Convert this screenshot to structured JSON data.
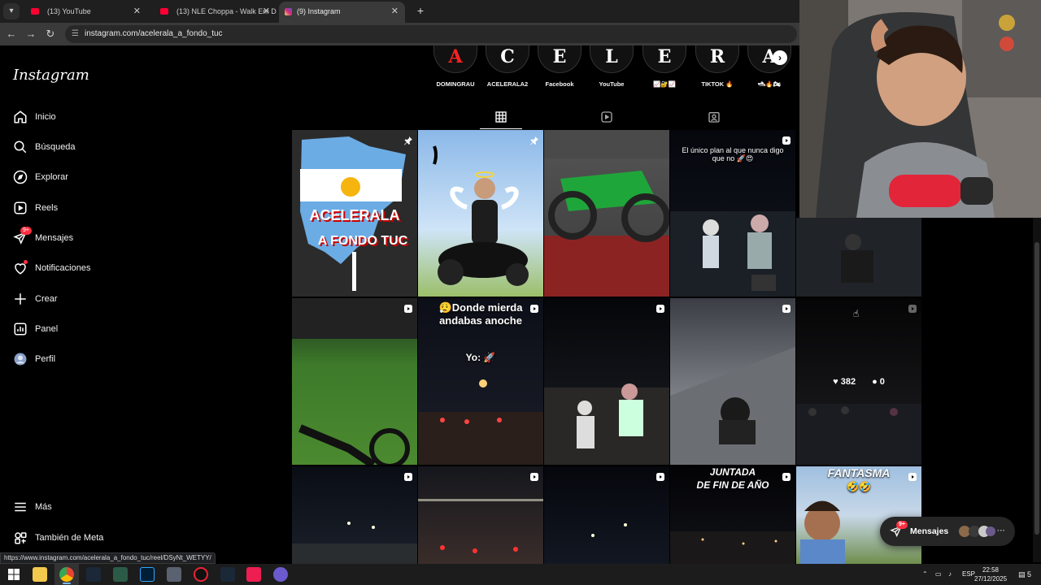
{
  "browser": {
    "tabs": [
      {
        "title": "(13) YouTube",
        "favicon_color": "#ff0033"
      },
      {
        "title": "(13) NLE Choppa - Walk Em Do",
        "favicon_color": "#ff0033"
      },
      {
        "title": "(9) Instagram",
        "favicon_color": "#e1306c"
      }
    ],
    "new_tab": "+",
    "url": "instagram.com/acelerala_a_fondo_tuc",
    "status_url": "https://www.instagram.com/acelerala_a_fondo_tuc/reel/DSyNt_WETYY/"
  },
  "sidebar": {
    "logo": "Instagram",
    "items": [
      {
        "label": "Inicio",
        "icon": "home-icon"
      },
      {
        "label": "Búsqueda",
        "icon": "search-icon"
      },
      {
        "label": "Explorar",
        "icon": "compass-icon"
      },
      {
        "label": "Reels",
        "icon": "reels-icon"
      },
      {
        "label": "Mensajes",
        "icon": "messenger-icon",
        "badge": "9+"
      },
      {
        "label": "Notificaciones",
        "icon": "heart-icon"
      },
      {
        "label": "Crear",
        "icon": "plus-icon"
      },
      {
        "label": "Panel",
        "icon": "dashboard-icon"
      },
      {
        "label": "Perfil",
        "icon": "avatar-icon"
      }
    ],
    "bottom": [
      {
        "label": "Más",
        "icon": "menu-icon"
      },
      {
        "label": "También de Meta",
        "icon": "meta-apps-icon"
      }
    ]
  },
  "highlights": [
    {
      "label": "DOMINGRAU",
      "glyph": "A",
      "glyph_color": "#ff2222"
    },
    {
      "label": "ACELERALA2",
      "glyph": "C",
      "glyph_color": "#ffffff"
    },
    {
      "label": "Facebook",
      "glyph": "E",
      "glyph_color": "#ffffff"
    },
    {
      "label": "YouTube",
      "glyph": "L",
      "glyph_color": "#ffffff"
    },
    {
      "label": "📈🔐📈",
      "glyph": "E",
      "glyph_color": "#ffffff"
    },
    {
      "label": "TIKTOK 🔥",
      "glyph": "R",
      "glyph_color": "#ffffff"
    },
    {
      "label": "🛥🔥🏍",
      "glyph": "A",
      "glyph_color": "#ffffff"
    }
  ],
  "profile_tabs": [
    "grid-icon",
    "reels-tab-icon",
    "tagged-icon"
  ],
  "posts": {
    "p1": {
      "title_line1": "ACELERALA",
      "title_line2": "A FONDO TUC"
    },
    "p4": {
      "caption": "El único plan al que nunca digo que no 🚀😍"
    },
    "p7": {
      "caption_line1": "😮‍💨Donde mierda",
      "caption_line2": "andabas anoche",
      "caption_line3": "Yo: 🚀"
    },
    "p10": {
      "likes": "382",
      "comments": "0"
    },
    "p14": {
      "caption_line1": "JUNTADA",
      "caption_line2": "DE FIN DE AÑO"
    },
    "p15": {
      "caption_line1": "FANTASMA",
      "caption_line2": "🤣🤣"
    }
  },
  "messages_pill": {
    "label": "Mensajes",
    "badge": "9+",
    "more": "···"
  },
  "taskbar": {
    "lang": "ESP",
    "time": "22:58",
    "date": "27/12/2025",
    "notif": "5"
  },
  "colors": {
    "ig_badge": "#ff3040",
    "bg": "#000000"
  }
}
